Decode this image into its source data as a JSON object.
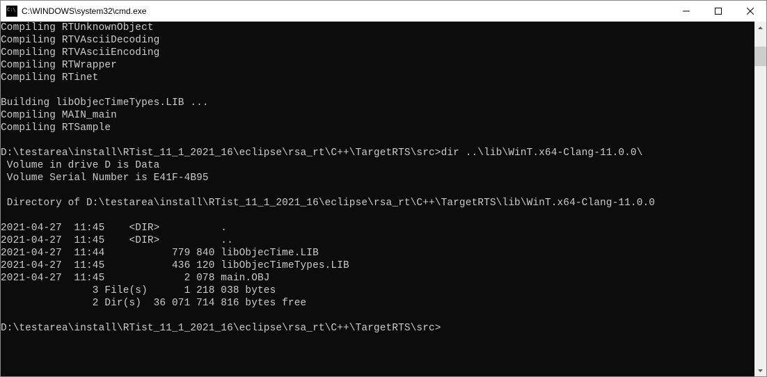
{
  "titlebar": {
    "title": "C:\\WINDOWS\\system32\\cmd.exe"
  },
  "console": {
    "lines": [
      "Compiling RTUnknownObject",
      "Compiling RTVAsciiDecoding",
      "Compiling RTVAsciiEncoding",
      "Compiling RTWrapper",
      "Compiling RTinet",
      "",
      "Building libObjecTimeTypes.LIB ...",
      "Compiling MAIN_main",
      "Compiling RTSample",
      "",
      "D:\\testarea\\install\\RTist_11_1_2021_16\\eclipse\\rsa_rt\\C++\\TargetRTS\\src>dir ..\\lib\\WinT.x64-Clang-11.0.0\\",
      " Volume in drive D is Data",
      " Volume Serial Number is E41F-4B95",
      "",
      " Directory of D:\\testarea\\install\\RTist_11_1_2021_16\\eclipse\\rsa_rt\\C++\\TargetRTS\\lib\\WinT.x64-Clang-11.0.0",
      "",
      "2021-04-27  11:45    <DIR>          .",
      "2021-04-27  11:45    <DIR>          ..",
      "2021-04-27  11:44           779 840 libObjecTime.LIB",
      "2021-04-27  11:45           436 120 libObjecTimeTypes.LIB",
      "2021-04-27  11:45             2 078 main.OBJ",
      "               3 File(s)      1 218 038 bytes",
      "               2 Dir(s)  36 071 714 816 bytes free",
      "",
      "D:\\testarea\\install\\RTist_11_1_2021_16\\eclipse\\rsa_rt\\C++\\TargetRTS\\src>"
    ]
  }
}
